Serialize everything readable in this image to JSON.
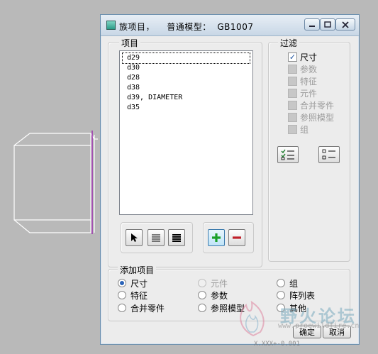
{
  "window": {
    "title": "族项目，    普通模型：  GB1007",
    "minimize_icon": "minimize-icon",
    "maximize_icon": "maximize-icon",
    "close_icon": "close-icon"
  },
  "items_group": {
    "label": "项目",
    "items": [
      "d29",
      "d30",
      "d28",
      "d38",
      "d39, DIAMETER",
      "d35"
    ],
    "selected_index": 0
  },
  "filter_group": {
    "label": "过滤",
    "options": [
      {
        "label": "尺寸",
        "checked": true,
        "enabled": true
      },
      {
        "label": "参数",
        "checked": false,
        "enabled": false
      },
      {
        "label": "特征",
        "checked": false,
        "enabled": false
      },
      {
        "label": "元件",
        "checked": false,
        "enabled": false
      },
      {
        "label": "合并零件",
        "checked": false,
        "enabled": false
      },
      {
        "label": "参照模型",
        "checked": false,
        "enabled": false
      },
      {
        "label": "组",
        "checked": false,
        "enabled": false
      }
    ]
  },
  "add_group": {
    "label": "添加项目",
    "options": [
      {
        "label": "尺寸",
        "checked": true,
        "enabled": true
      },
      {
        "label": "特征",
        "checked": false,
        "enabled": true
      },
      {
        "label": "合并零件",
        "checked": false,
        "enabled": true
      },
      {
        "label": "元件",
        "checked": false,
        "enabled": false
      },
      {
        "label": "参数",
        "checked": false,
        "enabled": true
      },
      {
        "label": "参照模型",
        "checked": false,
        "enabled": true
      },
      {
        "label": "组",
        "checked": false,
        "enabled": true
      },
      {
        "label": "阵列表",
        "checked": false,
        "enabled": true
      },
      {
        "label": "其他",
        "checked": false,
        "enabled": true
      }
    ]
  },
  "buttons": {
    "ok": "确定",
    "cancel": "取消"
  },
  "colors": {
    "accent_plus": "#1aa02a",
    "accent_minus": "#c0202a",
    "model_edge": "#9a2fae"
  },
  "watermark": {
    "text": "野火论坛",
    "url": "www.proewildfire.cn",
    "model_note": "X.XXX+-0.001"
  }
}
